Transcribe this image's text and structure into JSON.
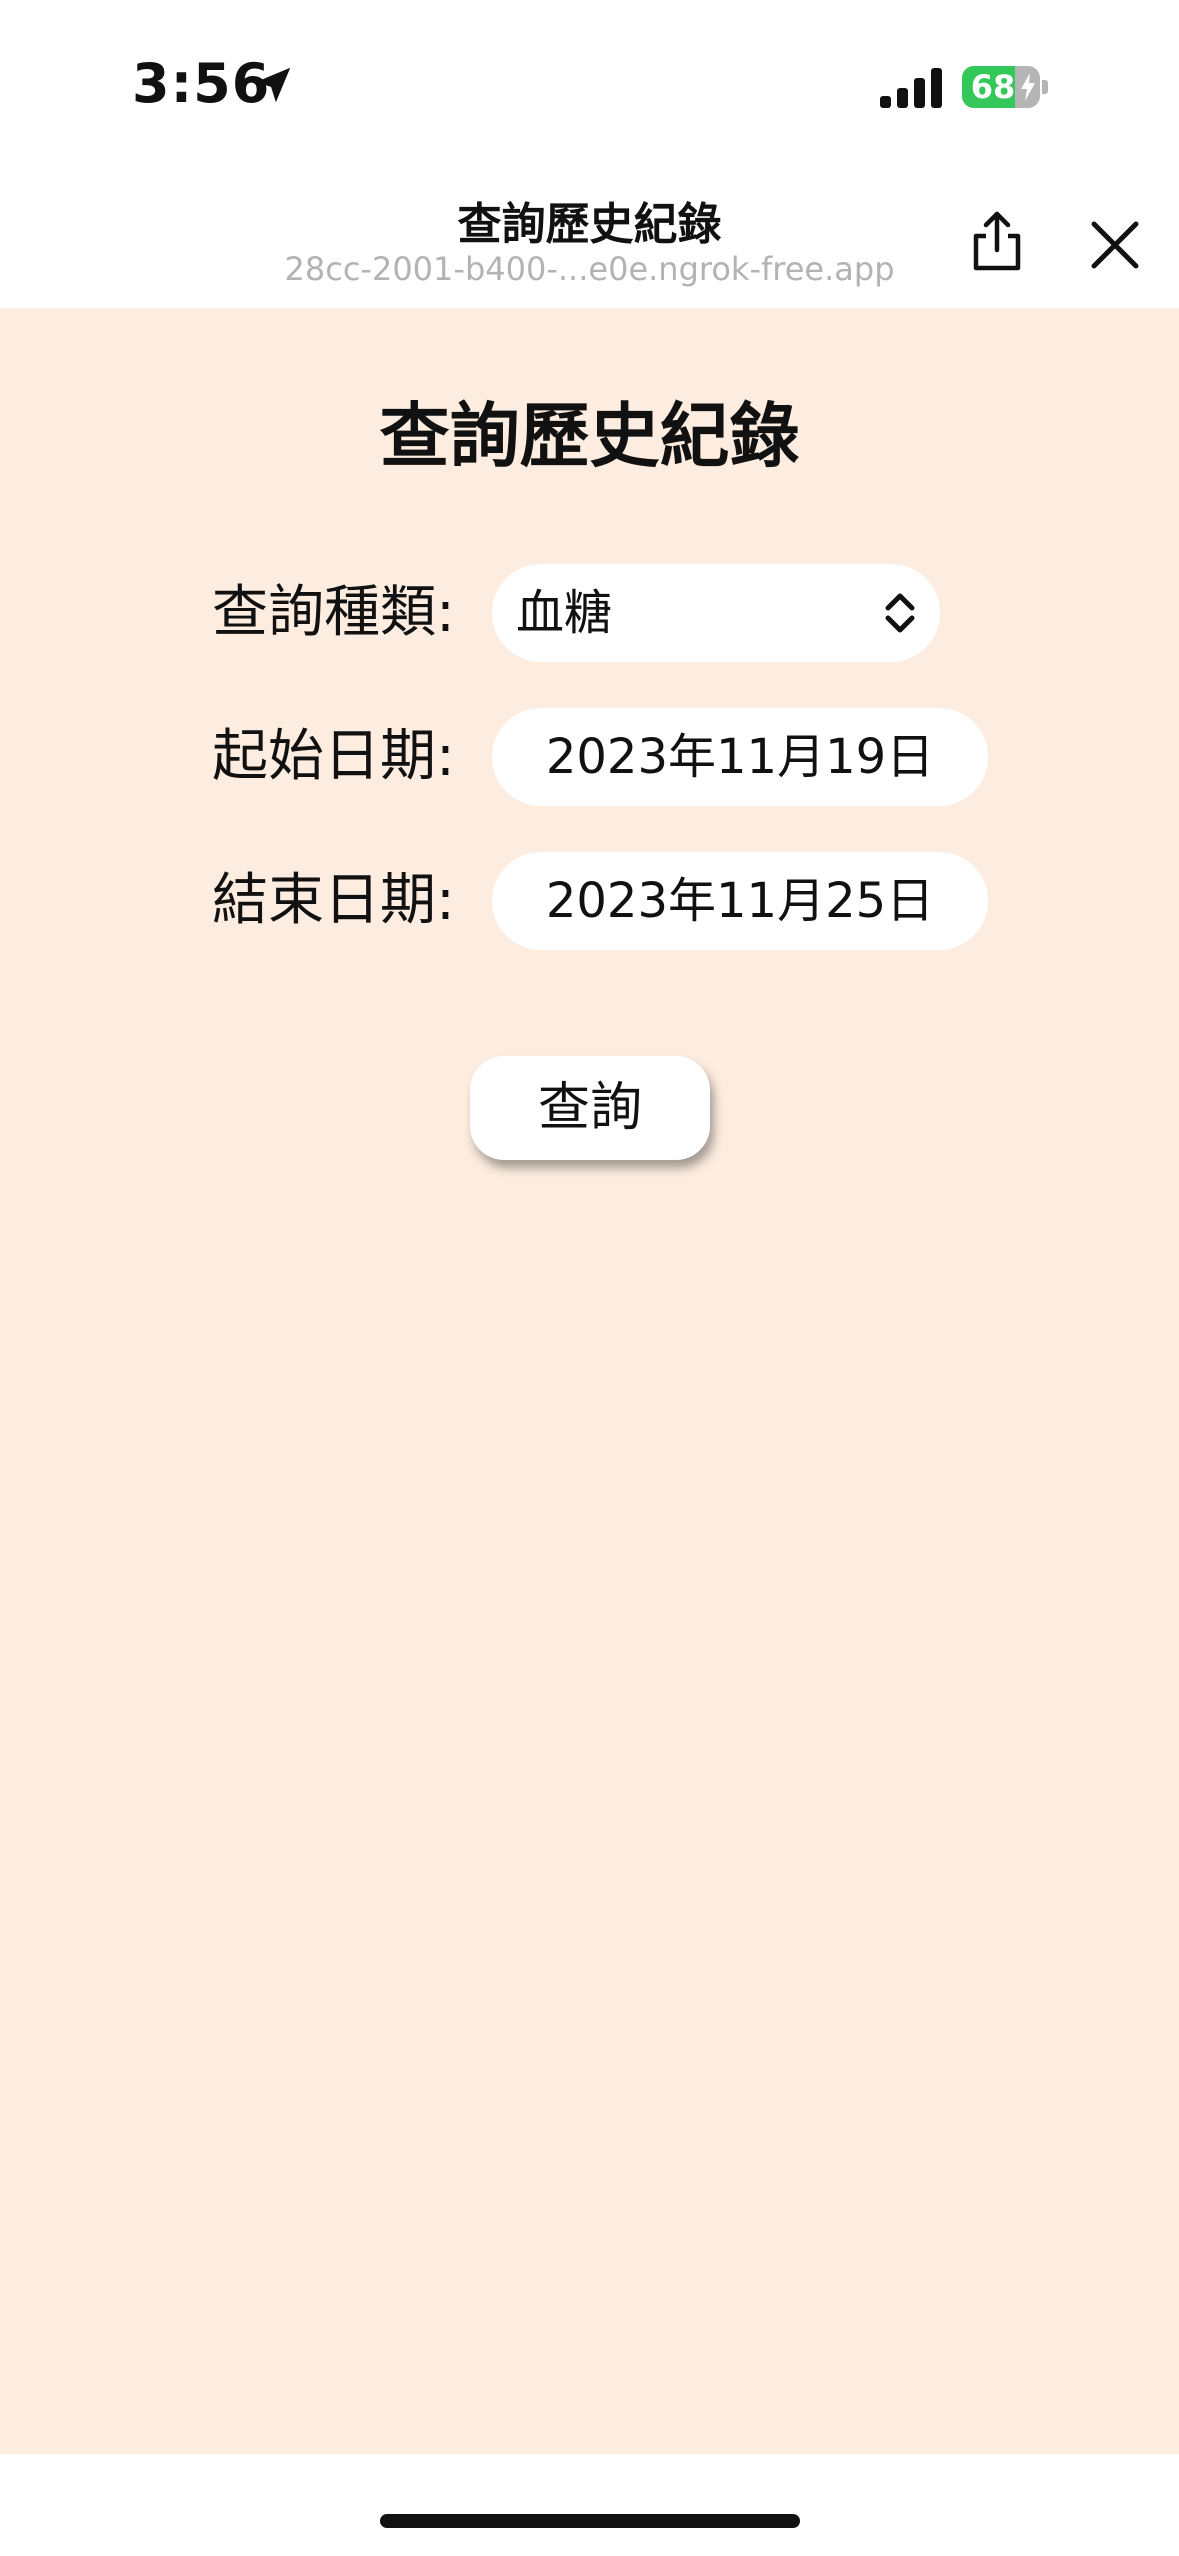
{
  "status_bar": {
    "time": "3:56",
    "battery_level": 68,
    "battery_text": "68",
    "location_icon": "location-arrow-icon",
    "signal_icon": "cellular-signal-icon",
    "charging_icon": "lightning-bolt-icon"
  },
  "browser": {
    "title": "查詢歷史紀錄",
    "url": "28cc-2001-b400-...e0e.ngrok-free.app",
    "share_icon": "share-icon",
    "close_icon": "close-icon"
  },
  "page": {
    "title": "查詢歷史紀錄",
    "form": {
      "type_label": "查詢種類:",
      "type_value": "血糖",
      "start_label": "起始日期:",
      "start_value": "2023年11月19日",
      "end_label": "結束日期:",
      "end_value": "2023年11月25日"
    },
    "submit_label": "查詢"
  },
  "colors": {
    "background": "#fdede0",
    "battery_fill": "#34c759",
    "url_text": "#b3b3b3"
  }
}
